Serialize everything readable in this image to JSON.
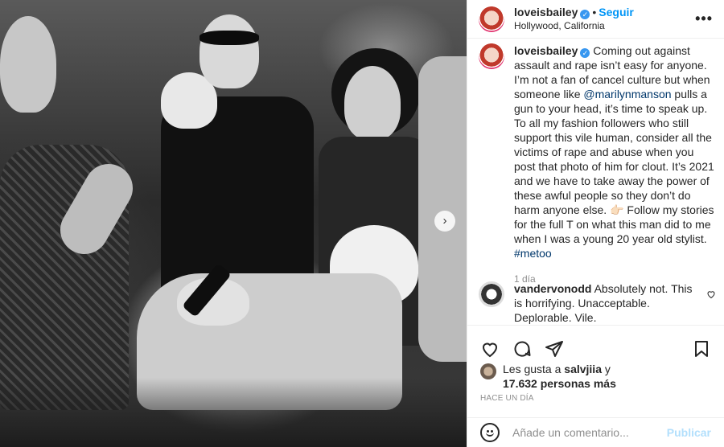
{
  "post": {
    "username": "loveisbailey",
    "follow_label": "Seguir",
    "location": "Hollywood, California",
    "more_label": "•••",
    "caption_parts": {
      "text1": "Coming out against assault and rape isn’t easy for anyone. I’m not a fan of cancel culture but when someone like ",
      "mention": "@marilynmanson",
      "text2": " pulls a gun to your head, it’s time to speak up. To all my fashion followers who still support this vile human, consider all the victims of rape and abuse when you post that photo of him for clout. It’s 2021 and we have to take away the power of these awful people so they don’t do harm anyone else. 👉🏻 Follow my stories for the full T on what this man did to me when I was a young 20 year old stylist. ",
      "hashtag": "#metoo"
    },
    "caption_time": "1 día"
  },
  "comment": {
    "username": "vandervonodd",
    "text": "Absolutely not. This is horrifying. Unacceptable. Deplorable. Vile."
  },
  "likes": {
    "prefix": "Les gusta a ",
    "user": "salvjiia",
    "conj": " y",
    "count_text": "17.632 personas más"
  },
  "posted_ago": "HACE UN DÍA",
  "add_comment": {
    "placeholder": "Añade un comentario...",
    "publish_label": "Publicar"
  },
  "icons": {
    "like": "heart-icon",
    "comment": "comment-icon",
    "share": "share-icon",
    "save": "bookmark-icon",
    "emoji": "emoji-icon",
    "next": "chevron-right-icon"
  },
  "colors": {
    "accent": "#0095f6",
    "link": "#00376b",
    "muted": "#8e8e8e",
    "publish_disabled": "#b2dffc"
  }
}
